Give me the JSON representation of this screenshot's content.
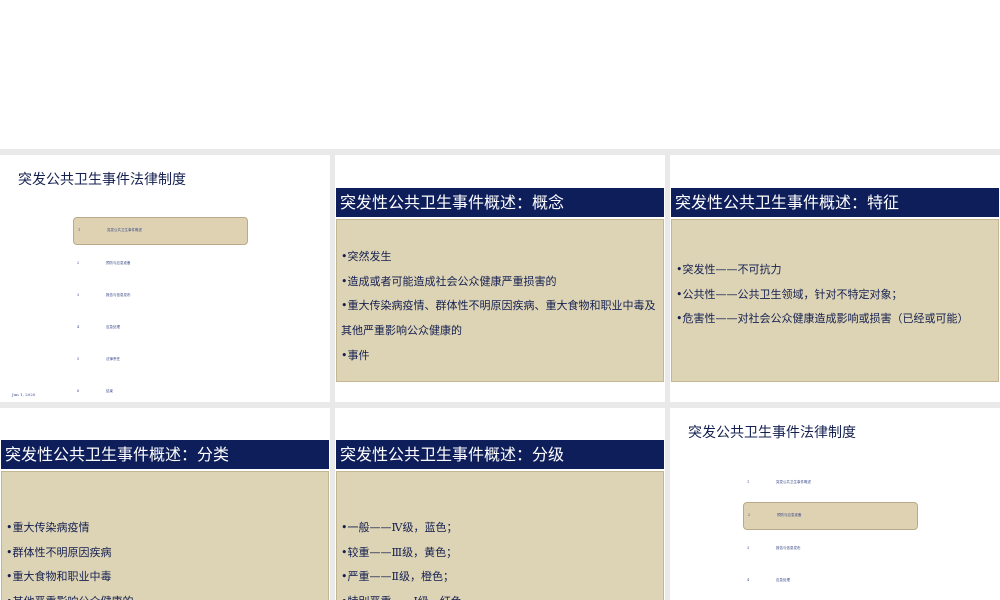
{
  "slide1": {
    "title": "突发公共卫生事件法律制度",
    "items": [
      {
        "num": "1",
        "label": "突发公共卫生事件概述"
      },
      {
        "num": "2",
        "label": "预防与应急准备"
      },
      {
        "num": "3",
        "label": "报告与信息发布"
      },
      {
        "num": "4",
        "label": "应急处理"
      },
      {
        "num": "5",
        "label": "法律责任"
      },
      {
        "num": "6",
        "label": "结束"
      }
    ],
    "date": "Jun 1, 2020"
  },
  "slide2": {
    "title": "突发性公共卫生事件概述：概念",
    "bullets": [
      "•突然发生",
      "•造成或者可能造成社会公众健康严重损害的",
      "•重大传染病疫情、群体性不明原因疾病、重大食物和职业中毒及其他严重影响公众健康的",
      "•事件"
    ]
  },
  "slide3": {
    "title": "突发性公共卫生事件概述：特征",
    "bullets": [
      "•突发性——不可抗力",
      "•公共性——公共卫生领域，针对不特定对象；",
      "•危害性——对社会公众健康造成影响或损害（已经或可能）"
    ]
  },
  "slide4": {
    "title": "突发性公共卫生事件概述：分类",
    "bullets": [
      "•重大传染病疫情",
      "•群体性不明原因疾病",
      "•重大食物和职业中毒",
      "•其他严重影响公众健康的"
    ]
  },
  "slide5": {
    "title": "突发性公共卫生事件概述：分级",
    "bullets": [
      "•一般——Ⅳ级，蓝色；",
      "•较重——Ⅲ级，黄色；",
      "•严重——Ⅱ级，橙色；",
      "•特别严重——Ⅰ级，红色"
    ]
  },
  "slide6": {
    "title": "突发公共卫生事件法律制度",
    "items": [
      {
        "num": "1",
        "label": "突发公共卫生事件概述"
      },
      {
        "num": "2",
        "label": "预防与应急准备"
      },
      {
        "num": "3",
        "label": "报告与信息发布"
      },
      {
        "num": "4",
        "label": "应急处理"
      }
    ]
  },
  "colors": {
    "header": "#0e1e5a",
    "content": "#ddd3b5",
    "text": "#142050",
    "highlight": "#dfd2b2"
  }
}
